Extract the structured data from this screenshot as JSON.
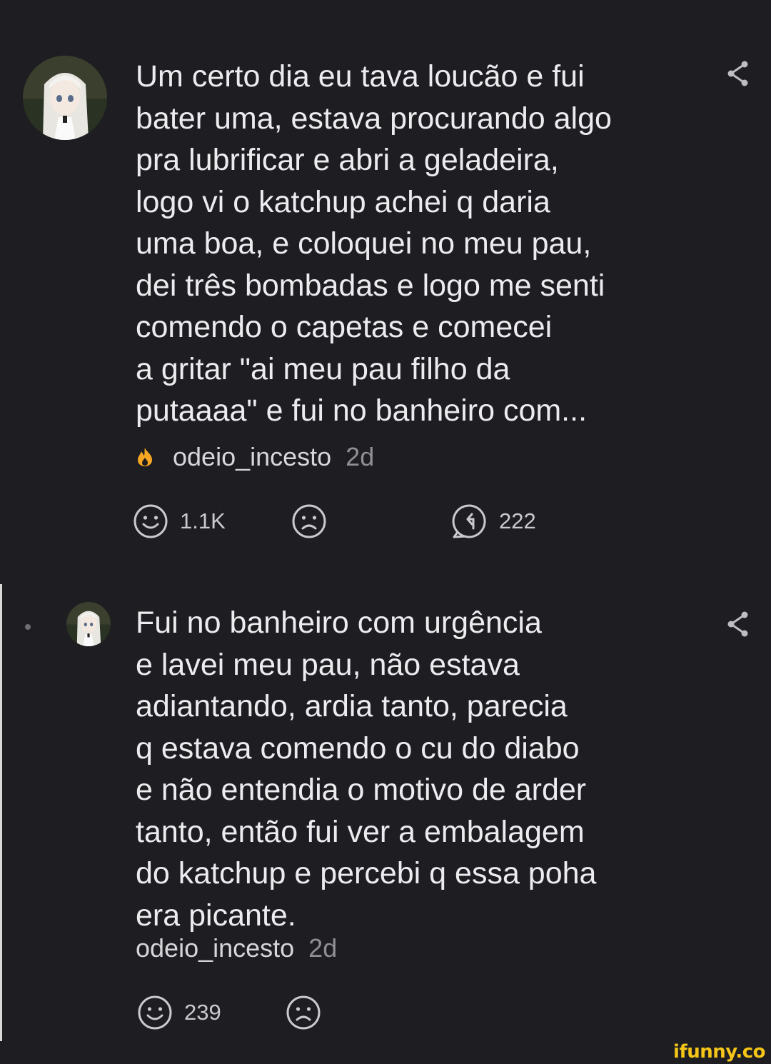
{
  "comments": [
    {
      "text": "Um certo dia eu tava loucão e fui\nbater uma, estava procurando algo\npra lubrificar e abri a geladeira,\nlogo vi o katchup achei q daria\numa boa, e coloquei no meu pau,\ndei três bombadas e logo me senti\ncomendo o capetas e comecei\na gritar \"ai meu pau filho da\nputaaaa\" e fui no banheiro com...",
      "author": "odeio_incesto",
      "time": "2d",
      "author_badge_icon": "fire-icon",
      "smile_count": "1.1K",
      "reply_count": "222"
    },
    {
      "text": "Fui no banheiro com urgência\ne lavei meu pau, não estava\nadiantando, ardia tanto, parecia\nq estava comendo o cu do diabo\ne não entendia o motivo de arder\ntanto, então fui ver a embalagem\ndo katchup e percebi q essa poha\nera picante.",
      "author": "odeio_incesto",
      "time": "2d",
      "smile_count": "239"
    }
  ],
  "watermark": "ifunny.co",
  "colors": {
    "background": "#1e1e22",
    "text": "#ececef",
    "muted": "#8f8f95",
    "badge": "#f5a623",
    "watermark": "#f5c518"
  }
}
